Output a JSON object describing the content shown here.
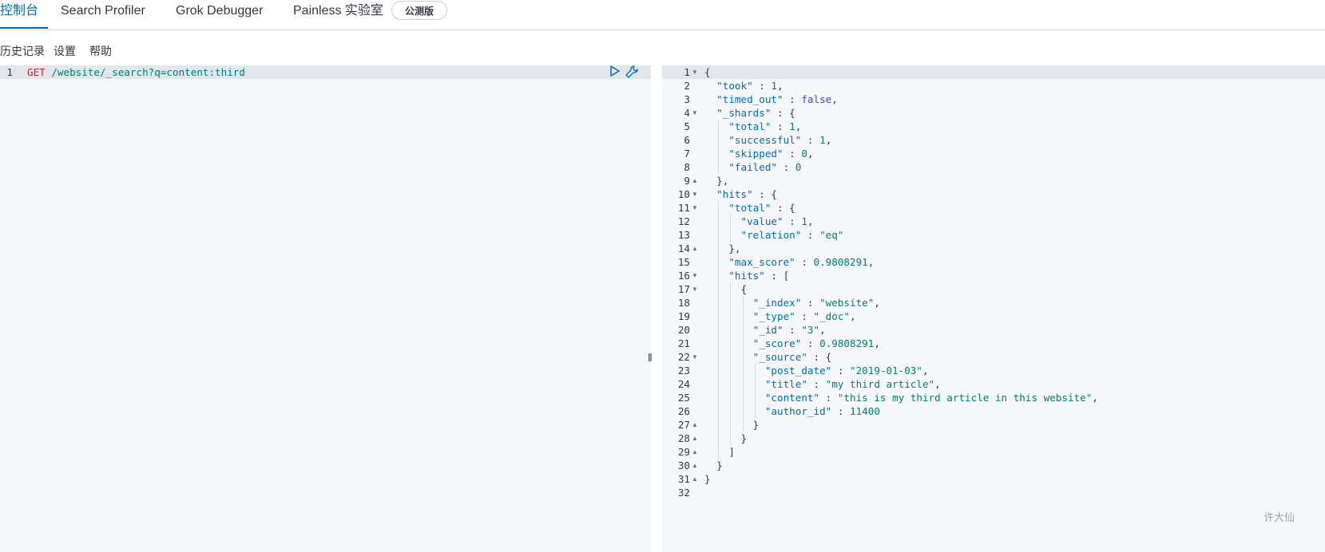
{
  "tabs": [
    {
      "label": "控制台",
      "active": true
    },
    {
      "label": "Search Profiler",
      "active": false
    },
    {
      "label": "Grok Debugger",
      "active": false
    },
    {
      "label": "Painless 实验室",
      "active": false
    }
  ],
  "beta_badge": "公测版",
  "menu": {
    "history": "历史记录",
    "settings": "设置",
    "help": "帮助"
  },
  "request": {
    "line_number": "1",
    "method": "GET",
    "path": "/website/_search?q=content:third"
  },
  "icons": {
    "run": "play-icon",
    "options": "wrench-icon"
  },
  "response_lines": [
    "{",
    "  \"took\" : 1,",
    "  \"timed_out\" : false,",
    "  \"_shards\" : {",
    "    \"total\" : 1,",
    "    \"successful\" : 1,",
    "    \"skipped\" : 0,",
    "    \"failed\" : 0",
    "  },",
    "  \"hits\" : {",
    "    \"total\" : {",
    "      \"value\" : 1,",
    "      \"relation\" : \"eq\"",
    "    },",
    "    \"max_score\" : 0.9808291,",
    "    \"hits\" : [",
    "      {",
    "        \"_index\" : \"website\",",
    "        \"_type\" : \"_doc\",",
    "        \"_id\" : \"3\",",
    "        \"_score\" : 0.9808291,",
    "        \"_source\" : {",
    "          \"post_date\" : \"2019-01-03\",",
    "          \"title\" : \"my third article\",",
    "          \"content\" : \"this is my third article in this website\",",
    "          \"author_id\" : 11400",
    "        }",
    "      }",
    "    ]",
    "  }",
    "}",
    ""
  ],
  "fold_markers": {
    "1": "open",
    "4": "open",
    "9": "close",
    "10": "open",
    "11": "open",
    "14": "close",
    "16": "open",
    "17": "open",
    "22": "open",
    "27": "close",
    "28": "close",
    "29": "close",
    "30": "close",
    "31": "close"
  },
  "watermark": "许大仙"
}
